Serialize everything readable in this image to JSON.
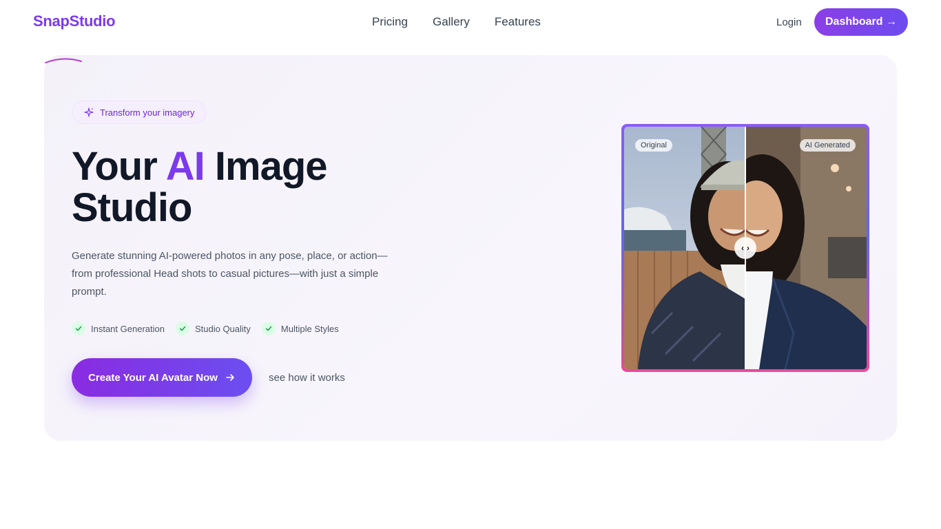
{
  "header": {
    "logo": "SnapStudio",
    "nav": [
      "Pricing",
      "Gallery",
      "Features"
    ],
    "login_label": "Login",
    "dashboard_label": "Dashboard →"
  },
  "hero": {
    "badge_text": "Transform your imagery",
    "title_part1": "Your ",
    "title_ai": "AI",
    "title_part2": " Image",
    "title_line2": "Studio",
    "description": "Generate stunning AI-powered photos in any pose, place, or action—from professional Head shots to casual pictures—with just a simple prompt.",
    "features": [
      "Instant Generation",
      "Studio Quality",
      "Multiple Styles"
    ],
    "cta_label": "Create Your AI Avatar Now",
    "secondary_link": "see how it works"
  },
  "comparison": {
    "left_label": "Original",
    "right_label": "AI Generated",
    "handle_left": "‹",
    "handle_right": "›"
  },
  "colors": {
    "brand": "#7c3aed",
    "accent_gradient_start": "#8a2be2",
    "accent_gradient_end": "#6b4ff0",
    "check_bg": "#dcfce7",
    "frame_pink": "#ec4899"
  },
  "icons": {
    "badge": "sparkle-icon",
    "feature": "check-icon",
    "cta": "arrow-right-icon",
    "handle": "chevron-left-right-icon"
  }
}
